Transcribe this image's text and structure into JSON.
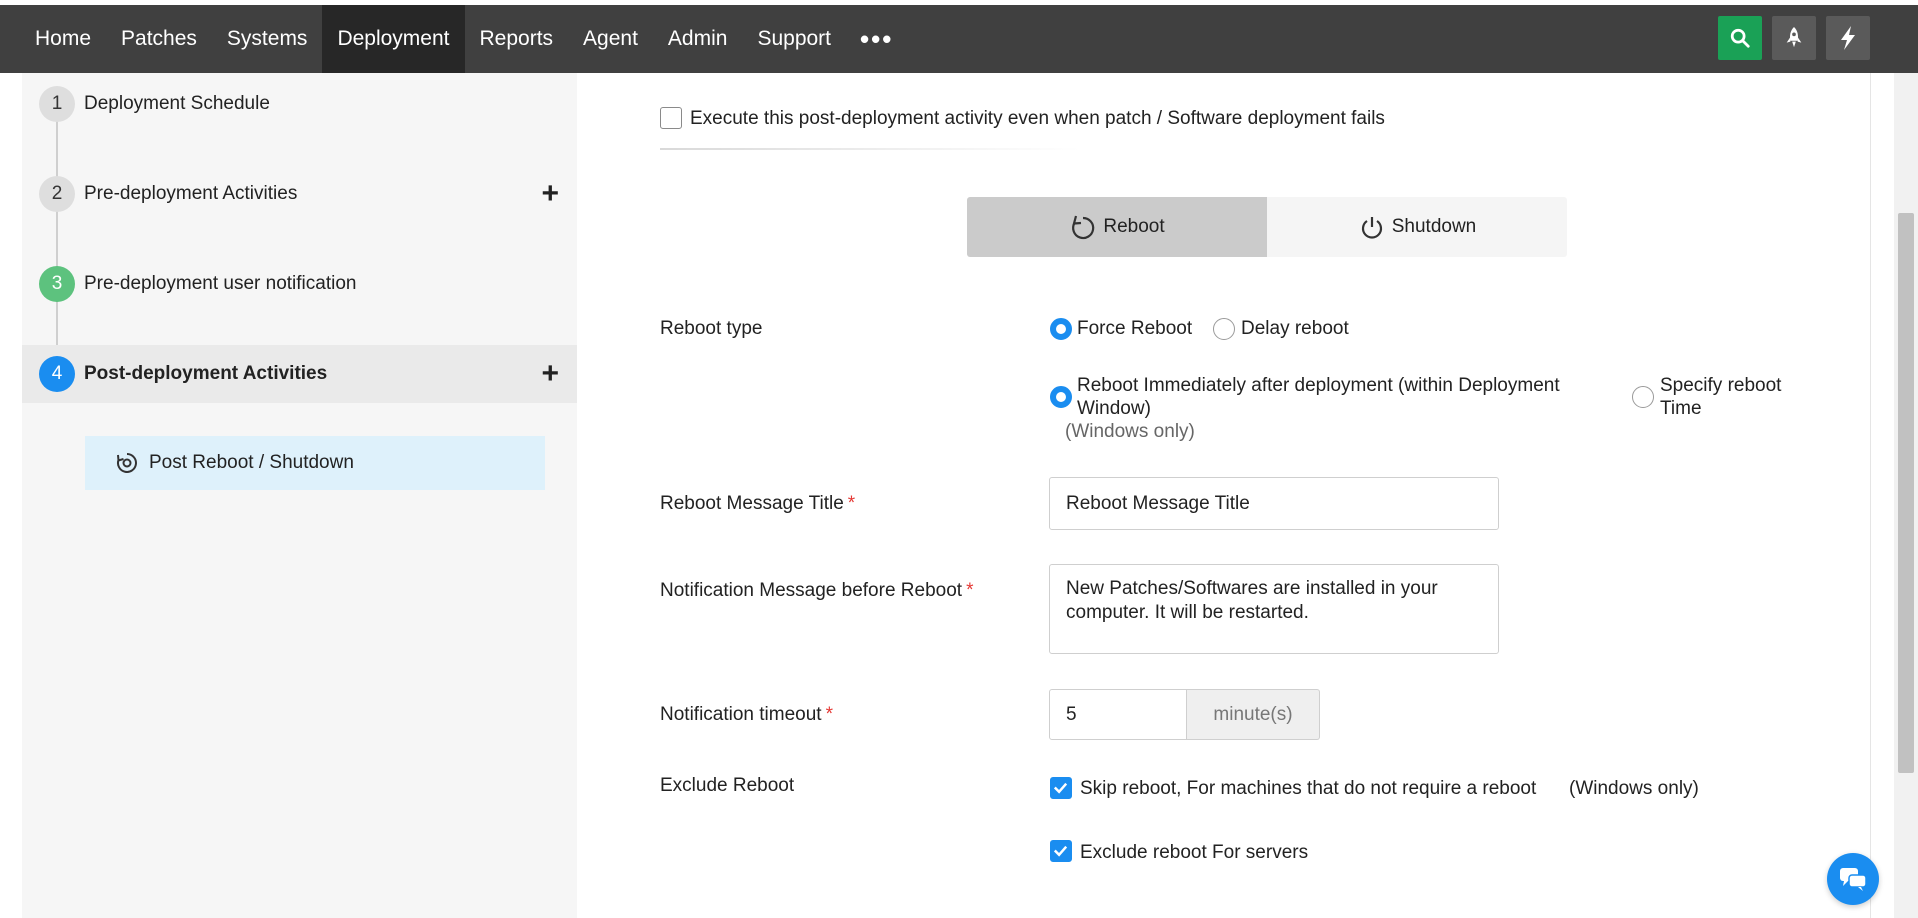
{
  "nav": {
    "items": [
      {
        "label": "Home"
      },
      {
        "label": "Patches"
      },
      {
        "label": "Systems"
      },
      {
        "label": "Deployment"
      },
      {
        "label": "Reports"
      },
      {
        "label": "Agent"
      },
      {
        "label": "Admin"
      },
      {
        "label": "Support"
      }
    ],
    "more_label": "•••",
    "active": "Deployment",
    "right_icons": [
      "search-icon",
      "rocket-icon",
      "lightning-icon"
    ],
    "search_color": "#1aa156"
  },
  "steps": [
    {
      "num": "1",
      "label": "Deployment Schedule",
      "has_plus": false
    },
    {
      "num": "2",
      "label": "Pre-deployment Activities",
      "has_plus": true
    },
    {
      "num": "3",
      "label": "Pre-deployment user notification",
      "has_plus": false
    },
    {
      "num": "4",
      "label": "Post-deployment Activities",
      "has_plus": true
    }
  ],
  "plus_glyph": "+",
  "subitem": {
    "label": "Post Reboot / Shutdown",
    "icon": "reboot-gear-icon"
  },
  "form": {
    "execute_fail_label": "Execute this post-deployment activity even when patch / Software deployment fails",
    "execute_fail_checked": false,
    "segment": {
      "reboot_label": "Reboot",
      "shutdown_label": "Shutdown",
      "selected": "Reboot"
    },
    "reboot_type": {
      "label": "Reboot type",
      "options": [
        "Force Reboot",
        "Delay reboot"
      ],
      "selected": "Force Reboot"
    },
    "timing": {
      "immediate_label_line1": "Reboot Immediately after deployment (within Deployment",
      "immediate_label_line2": "Window)",
      "immediate_note": "(Windows only)",
      "specify_label_line1": "Specify reboot",
      "specify_label_line2": "Time",
      "selected": "immediate"
    },
    "message_title": {
      "label": "Reboot Message Title",
      "value": "Reboot Message Title",
      "required_mark": "*"
    },
    "notification_message": {
      "label": "Notification Message before Reboot",
      "value": "New Patches/Softwares are installed in your\ncomputer. It will be restarted.",
      "required_mark": "*"
    },
    "timeout": {
      "label": "Notification timeout",
      "value": "5",
      "unit": "minute(s)",
      "required_mark": "*"
    },
    "exclude": {
      "label": "Exclude Reboot",
      "skip_label": "Skip reboot, For machines that do not require a reboot",
      "skip_note": "(Windows only)",
      "skip_checked": true,
      "servers_label": "Exclude reboot For servers",
      "servers_checked": true
    }
  },
  "colors": {
    "accent": "#1a8df0",
    "step_done": "#5dc27e",
    "required": "#e53935"
  }
}
